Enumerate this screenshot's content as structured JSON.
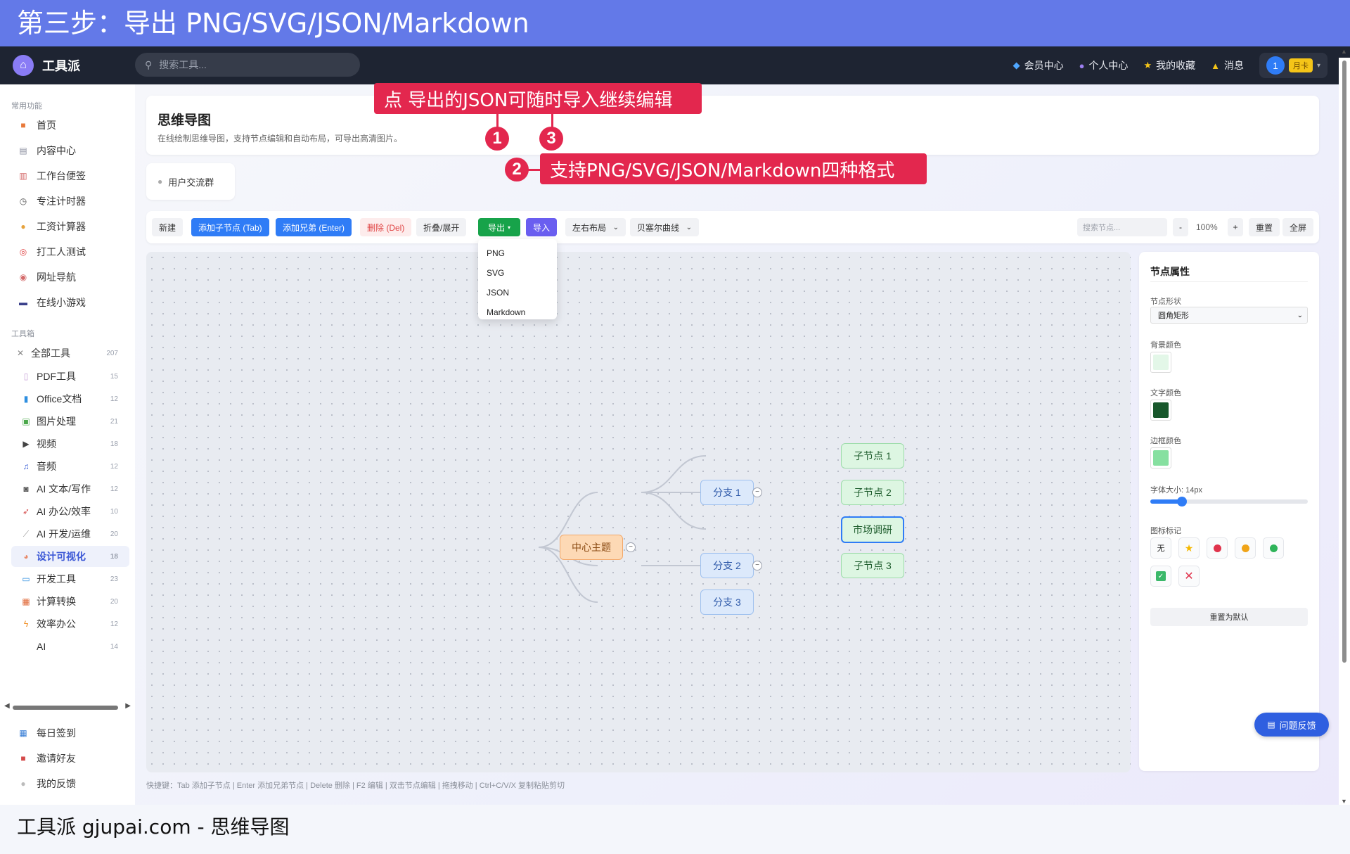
{
  "banner": {
    "text": "第三步：导出 PNG/SVG/JSON/Markdown"
  },
  "navbar": {
    "brand": "工具派",
    "search_placeholder": "搜索工具...",
    "items": [
      {
        "icon": "diamond-icon",
        "label": "会员中心"
      },
      {
        "icon": "person-icon",
        "label": "个人中心"
      },
      {
        "icon": "star-icon",
        "label": "我的收藏"
      },
      {
        "icon": "bell-icon",
        "label": "消息"
      }
    ],
    "avatar_text": "1",
    "badge": "月卡"
  },
  "sidebar": {
    "section_common": "常用功能",
    "common": [
      {
        "icon": "home-icon",
        "label": "首页"
      },
      {
        "icon": "content-icon",
        "label": "内容中心"
      },
      {
        "icon": "note-icon",
        "label": "工作台便签"
      },
      {
        "icon": "timer-icon",
        "label": "专注计时器"
      },
      {
        "icon": "money-icon",
        "label": "工资计算器"
      },
      {
        "icon": "target-icon",
        "label": "打工人测试"
      },
      {
        "icon": "compass-icon",
        "label": "网址导航"
      },
      {
        "icon": "gamepad-icon",
        "label": "在线小游戏"
      }
    ],
    "section_tools": "工具箱",
    "tools": [
      {
        "icon": "tools-icon",
        "label": "全部工具",
        "count": "207"
      },
      {
        "icon": "pdf-icon",
        "label": "PDF工具",
        "count": "15"
      },
      {
        "icon": "office-icon",
        "label": "Office文档",
        "count": "12"
      },
      {
        "icon": "image-icon",
        "label": "图片处理",
        "count": "21"
      },
      {
        "icon": "video-icon",
        "label": "视频",
        "count": "18"
      },
      {
        "icon": "music-icon",
        "label": "音频",
        "count": "12"
      },
      {
        "icon": "robot-icon",
        "label": "AI 文本/写作",
        "count": "12"
      },
      {
        "icon": "rocket-icon",
        "label": "AI 办公/效率",
        "count": "10"
      },
      {
        "icon": "wrench-icon",
        "label": "AI 开发/运维",
        "count": "20"
      },
      {
        "icon": "palette-icon",
        "label": "设计可视化",
        "count": "18"
      },
      {
        "icon": "monitor-icon",
        "label": "开发工具",
        "count": "23"
      },
      {
        "icon": "calculator-icon",
        "label": "计算转换",
        "count": "20"
      },
      {
        "icon": "bolt-icon",
        "label": "效率办公",
        "count": "12"
      },
      {
        "icon": "",
        "label": "AI",
        "count": "14"
      }
    ],
    "bottom": [
      {
        "icon": "calendar-icon",
        "label": "每日签到"
      },
      {
        "icon": "gift-icon",
        "label": "邀请好友"
      },
      {
        "icon": "chat-icon",
        "label": "我的反馈"
      }
    ]
  },
  "header": {
    "title": "思维导图",
    "subtitle": "在线绘制思维导图，支持节点编辑和自动布局，可导出高清图片。",
    "group_label": "用户交流群"
  },
  "toolbar": {
    "new": "新建",
    "add_child": "添加子节点 (Tab)",
    "add_sibling": "添加兄弟 (Enter)",
    "delete": "删除 (Del)",
    "collapse": "折叠/展开",
    "export": "导出",
    "import": "导入",
    "layout": "左右布局",
    "curve": "贝塞尔曲线",
    "search_placeholder": "搜索节点...",
    "zoom_out": "-",
    "zoom": "100%",
    "zoom_in": "+",
    "reset": "重置",
    "fullscreen": "全屏"
  },
  "export_menu": [
    "PNG",
    "SVG",
    "JSON",
    "Markdown"
  ],
  "mindmap": {
    "center": "中心主题",
    "branches": [
      "分支 1",
      "分支 2",
      "分支 3"
    ],
    "leaves": [
      "子节点 1",
      "子节点 2",
      "市场调研",
      "子节点 3"
    ],
    "toggle": "−"
  },
  "panel": {
    "title": "节点属性",
    "shape_label": "节点形状",
    "shape_value": "圆角矩形",
    "bg_label": "背景颜色",
    "bg_color": "#e3f7e8",
    "text_label": "文字颜色",
    "text_color": "#17572b",
    "border_label": "边框颜色",
    "border_color": "#86e0a0",
    "font_label": "字体大小: 14px",
    "font_value": 14,
    "icon_label": "图标标记",
    "icon_none": "无",
    "reset": "重置为默认"
  },
  "shortcut": "快捷键：Tab 添加子节点 | Enter 添加兄弟节点 | Delete 删除 | F2 编辑 | 双击节点编辑 | 拖拽移动 | Ctrl+C/V/X 复制粘贴剪切",
  "feedback": "问题反馈",
  "callouts": {
    "c1": "点  导出的JSON可随时导入继续编辑",
    "c2": "支持PNG/SVG/JSON/Markdown四种格式",
    "n1": "1",
    "n2": "2",
    "n3": "3"
  },
  "footer": "工具派 gjupai.com - 思维导图"
}
